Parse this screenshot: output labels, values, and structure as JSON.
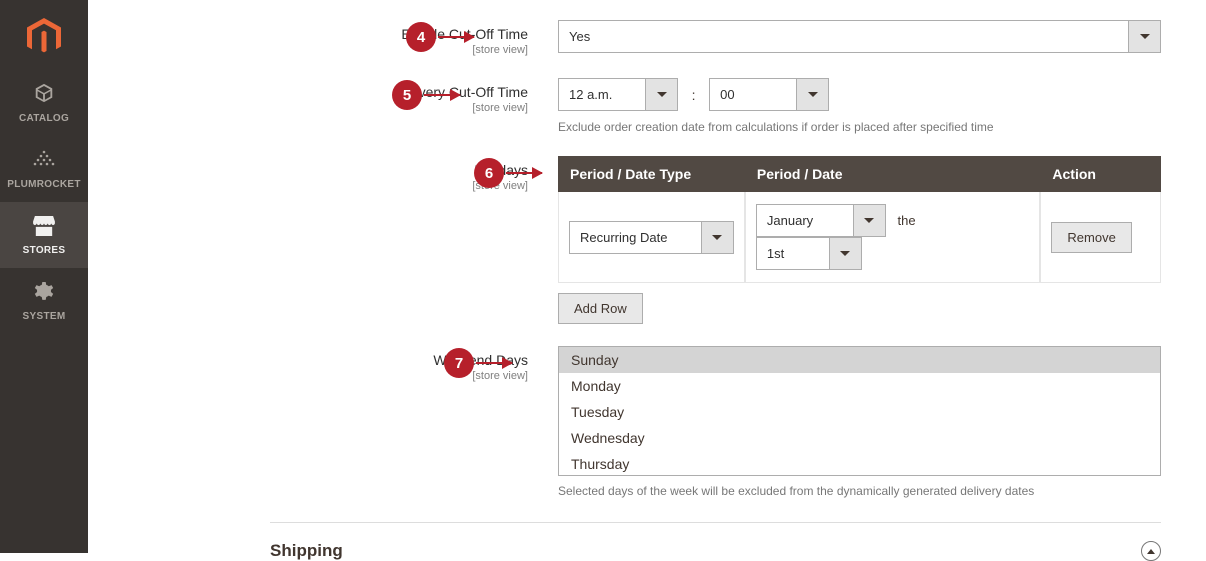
{
  "sidebar": {
    "items": [
      {
        "label": "CATALOG"
      },
      {
        "label": "PLUMROCKET"
      },
      {
        "label": "STORES"
      },
      {
        "label": "SYSTEM"
      }
    ]
  },
  "badges": {
    "b4": "4",
    "b5": "5",
    "b6": "6",
    "b7": "7"
  },
  "fields": {
    "enableCutoff": {
      "label": "Enable Cut-Off Time",
      "scope": "[store view]",
      "value": "Yes"
    },
    "deliveryCutoff": {
      "label": "Delivery Cut-Off Time",
      "scope": "[store view]",
      "hour": "12 a.m.",
      "minute": "00",
      "hint": "Exclude order creation date from calculations if order is placed after specified time",
      "colon": ":"
    },
    "holidays": {
      "label": "Holidays",
      "scope": "[store view]",
      "th1": "Period / Date Type",
      "th2": "Period / Date",
      "th3": "Action",
      "type": "Recurring Date",
      "month": "January",
      "the": "the",
      "day": "1st",
      "remove": "Remove",
      "addRow": "Add Row"
    },
    "weekend": {
      "label": "Weekend Days",
      "scope": "[store view]",
      "hint": "Selected days of the week will be excluded from the dynamically generated delivery dates",
      "days": [
        "Sunday",
        "Monday",
        "Tuesday",
        "Wednesday",
        "Thursday"
      ],
      "selected": "Sunday"
    }
  },
  "section": {
    "title": "Shipping"
  }
}
